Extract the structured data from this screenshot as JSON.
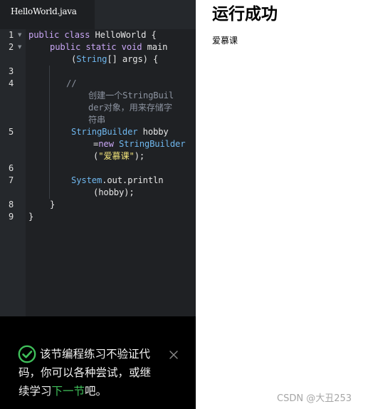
{
  "editor": {
    "tab_label": "HelloWorld.java",
    "line_numbers": [
      "1",
      "2",
      "3",
      "4",
      "5",
      "6",
      "7",
      "8",
      "9"
    ],
    "fold_marker": "▼",
    "lines": {
      "l1": {
        "kw1": "public",
        "kw2": "class",
        "name": "HelloWorld",
        "brace": "{"
      },
      "l2": {
        "kw1": "public",
        "kw2": "static",
        "kw3": "void",
        "name": "main",
        "open": "(",
        "type": "String",
        "rest": "[] args) {"
      },
      "l4": {
        "slashes": "//",
        "c1": "创建一个StringBuil",
        "c2": "der对象，用来存储字",
        "c3": "符串"
      },
      "l5": {
        "type": "StringBuilder",
        "var": "hobby",
        "eq": "=",
        "kw": "new",
        "ctor": "StringBuilder",
        "open": "(",
        "str": "\"爱慕课\"",
        "close": ");"
      },
      "l7": {
        "obj": "System",
        "rest1": ".out.println",
        "rest2": "(hobby);"
      },
      "l8": {
        "brace": "}"
      },
      "l9": {
        "brace": "}"
      }
    }
  },
  "notice": {
    "text_before": "该节编程练习不验证代码，你可以各种尝试，或继续学习",
    "link": "下一节",
    "text_after": "吧。",
    "accent": "#3fbf5a"
  },
  "result": {
    "title": "运行成功",
    "output": "爱慕课"
  },
  "watermark": "CSDN @大丑253",
  "colors": {
    "keyword": "#c9a6f5",
    "type": "#6fb7ee",
    "string": "#f1e27a",
    "comment": "#8c93a0",
    "editor_bg": "#1f2124"
  }
}
